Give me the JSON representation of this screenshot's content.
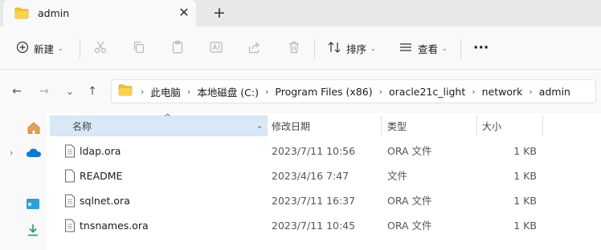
{
  "tab": {
    "title": "admin",
    "close_glyph": "✕",
    "new_tab_glyph": "+"
  },
  "toolbar": {
    "new_label": "新建",
    "sort_label": "排序",
    "view_label": "查看",
    "more_glyph": "···",
    "chevron_glyph": "⌄"
  },
  "nav": {
    "back_glyph": "←",
    "forward_glyph": "→",
    "recent_glyph": "⌄",
    "up_glyph": "↑",
    "crumb_sep": "›",
    "breadcrumbs": [
      "此电脑",
      "本地磁盘 (C:)",
      "Program Files (x86)",
      "oracle21c_light",
      "network",
      "admin"
    ]
  },
  "columns": {
    "name": "名称",
    "modified": "修改日期",
    "type": "类型",
    "size": "大小",
    "sort_glyph": "^"
  },
  "files": [
    {
      "name": "ldap.ora",
      "modified": "2023/7/11 10:56",
      "type": "ORA 文件",
      "size": "1 KB"
    },
    {
      "name": "README",
      "modified": "2023/4/16 7:47",
      "type": "文件",
      "size": "1 KB"
    },
    {
      "name": "sqlnet.ora",
      "modified": "2023/7/11 16:37",
      "type": "ORA 文件",
      "size": "1 KB"
    },
    {
      "name": "tnsnames.ora",
      "modified": "2023/7/11 10:45",
      "type": "ORA 文件",
      "size": "1 KB"
    }
  ],
  "colors": {
    "accent": "#0067c0",
    "folder": "#f4c02f",
    "header_active": "#d7e8f6"
  }
}
